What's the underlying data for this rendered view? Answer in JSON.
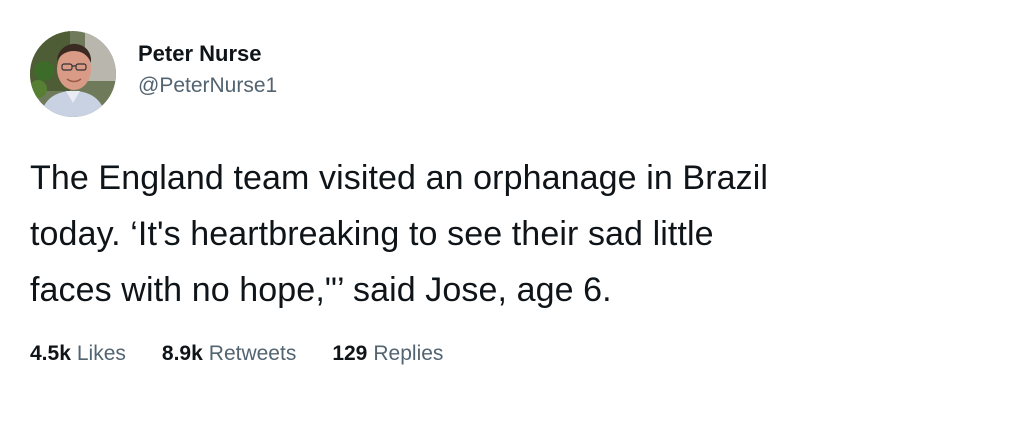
{
  "author": {
    "display_name": "Peter Nurse",
    "handle": "@PeterNurse1",
    "avatar_icon": "profile-photo"
  },
  "tweet": {
    "lines": [
      "The England team visited an orphanage in Brazil",
      "today. ‘It's heartbreaking to see their sad little",
      "faces with no hope,\"’ said Jose, age 6."
    ]
  },
  "stats": {
    "likes": {
      "count": "4.5k",
      "label": "Likes"
    },
    "retweets": {
      "count": "8.9k",
      "label": "Retweets"
    },
    "replies": {
      "count": "129",
      "label": "Replies"
    }
  },
  "colors": {
    "text_primary": "#0f1419",
    "text_secondary": "#536471",
    "background": "#ffffff"
  }
}
